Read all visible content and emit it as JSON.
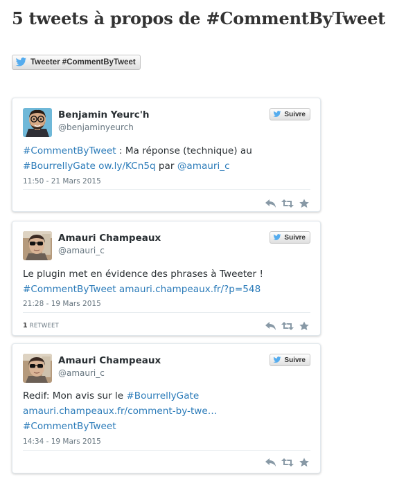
{
  "page": {
    "title": "5 tweets à propos de #CommentByTweet",
    "tweet_button": "Tweeter #CommentByTweet"
  },
  "colors": {
    "link": "#2b7bb9",
    "muted": "#66757f",
    "twitter_blue": "#55acee"
  },
  "icons": {
    "button": "twitter-bird-icon",
    "actions": [
      "reply-icon",
      "retweet-icon",
      "favorite-star-icon"
    ]
  },
  "tweets": [
    {
      "author": "Benjamin Yeurc'h",
      "handle": "@benjaminyeurch",
      "follow_label": "Suivre",
      "text_line1_link": "#CommentByTweet",
      "text_line1_rest": " : Ma réponse (technique) au",
      "text_line2_link1": "#BourrellyGate",
      "text_line2_space": " ",
      "text_line2_link2": "ow.ly/KCn5q",
      "text_line2_mid": " par ",
      "text_line2_link3": "@amauri_c",
      "date": "11:50 - 21 Mars 2015",
      "retweet_count": "",
      "retweet_label": ""
    },
    {
      "author": "Amauri Champeaux",
      "handle": "@amauri_c",
      "follow_label": "Suivre",
      "text_line1": "Le plugin met en évidence des phrases à Tweeter !",
      "text_line2_link1": "#CommentByTweet",
      "text_line2_space": " ",
      "text_line2_link2": "amauri.champeaux.fr/?p=548",
      "date": "21:28 - 19 Mars 2015",
      "retweet_count": "1",
      "retweet_label": "RETWEET"
    },
    {
      "author": "Amauri Champeaux",
      "handle": "@amauri_c",
      "follow_label": "Suivre",
      "text_line1_plain": "Redif: Mon avis sur le ",
      "text_line1_link": "#BourrellyGate",
      "text_line2_link": "amauri.champeaux.fr/comment-by-twe…",
      "text_line3_link": "#CommentByTweet",
      "date": "14:34 - 19 Mars 2015",
      "retweet_count": "",
      "retweet_label": ""
    }
  ]
}
